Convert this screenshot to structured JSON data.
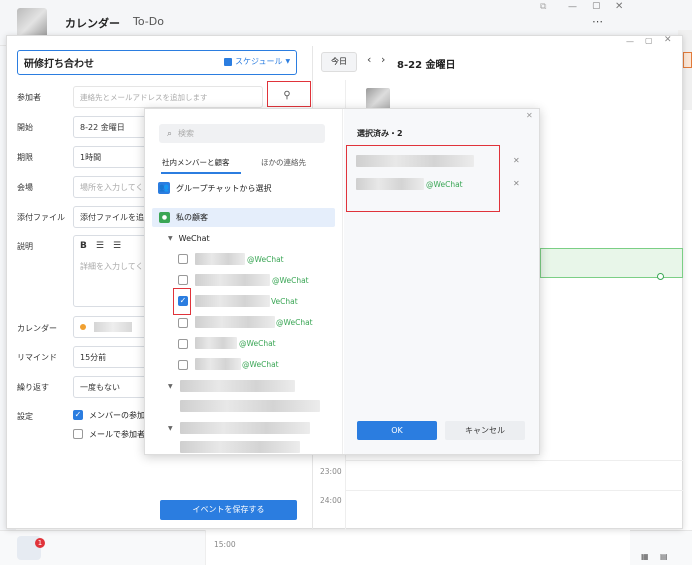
{
  "app": {
    "tab_calendar": "カレンダー",
    "tab_todo": "To-Do"
  },
  "event_form": {
    "title_value": "研修打ち合わせ",
    "category": "スケジュール",
    "labels": {
      "attendees": "参加者",
      "start": "開始",
      "duration": "期限",
      "location": "会場",
      "attachment": "添付ファイル",
      "description": "説明",
      "calendar": "カレンダー",
      "remind": "リマインド",
      "repeat": "繰り返す",
      "settings": "設定"
    },
    "attendee_placeholder": "連絡先とメールアドレスを追加します",
    "start_value": "8-22 金曜日",
    "duration_value": "1時間",
    "location_placeholder": "場所を入力してく",
    "attachment_button": "添付ファイルを追",
    "description_placeholder": "詳細を入力してく",
    "remind_value": "15分前",
    "repeat_value": "一度もない",
    "setting_option1": "メンバーの参加",
    "setting_option2": "メールで参加者",
    "save_button": "イベントを保存する"
  },
  "calendar_view": {
    "today_button": "今日",
    "date_label": "8-22 金曜日",
    "times": [
      "23:00",
      "24:00",
      "15:00"
    ]
  },
  "picker": {
    "search_placeholder": "検索",
    "tab_internal": "社内メンバーと顧客",
    "tab_other": "ほかの連絡先",
    "group_chat": "グループチャットから選択",
    "my_customers": "私の顧客",
    "wechat_group": "WeChat",
    "contacts": [
      {
        "suffix": "@WeChat",
        "checked": false
      },
      {
        "suffix": "@WeChat",
        "checked": false
      },
      {
        "suffix": "VeChat",
        "checked": true
      },
      {
        "suffix": "@WeChat",
        "checked": false
      },
      {
        "suffix": "@WeChat",
        "checked": false
      },
      {
        "suffix": "@WeChat",
        "checked": false
      }
    ],
    "selected_header": "選択済み・2",
    "selected_suffix": "@WeChat",
    "ok_button": "OK",
    "cancel_button": "キャンセル"
  },
  "badge_count": "1",
  "colors": {
    "accent": "#2b7de0",
    "wechat": "#3aa655",
    "highlight": "#e0333a"
  }
}
